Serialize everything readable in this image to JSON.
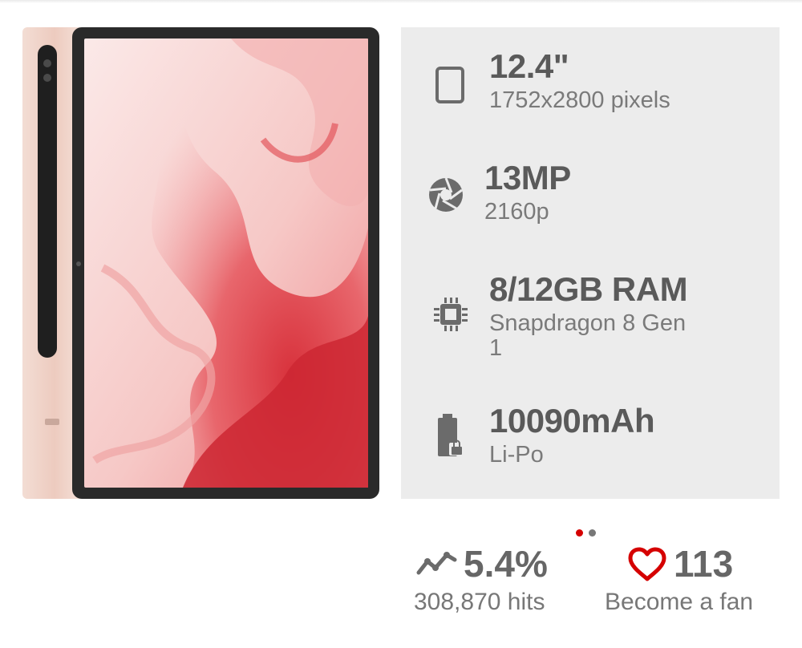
{
  "specs": {
    "display": {
      "title": "12.4\"",
      "subtitle": "1752x2800 pixels",
      "icon": "tablet-icon"
    },
    "camera": {
      "title": "13MP",
      "subtitle": "2160p",
      "icon": "camera-aperture-icon"
    },
    "memory": {
      "title": "8/12GB RAM",
      "subtitle_line1": "Snapdragon 8 Gen",
      "subtitle_line2": "1",
      "icon": "chip-icon"
    },
    "battery": {
      "title": "10090mAh",
      "subtitle": "Li-Po",
      "icon": "battery-icon"
    }
  },
  "stats": {
    "popularity": {
      "value": "5.4%",
      "label": "308,870 hits",
      "icon": "trend-icon"
    },
    "fans": {
      "value": "113",
      "label": "Become a fan",
      "icon": "heart-icon"
    }
  },
  "pager": {
    "page_count": 2,
    "active_index": 0
  },
  "colors": {
    "accent": "#d50000",
    "panel_bg": "#ececec",
    "text_dark": "#5a5a5a",
    "text_light": "#7a7a7a",
    "device_pink": "#efcfc3",
    "screen_red": "#e2444c"
  }
}
